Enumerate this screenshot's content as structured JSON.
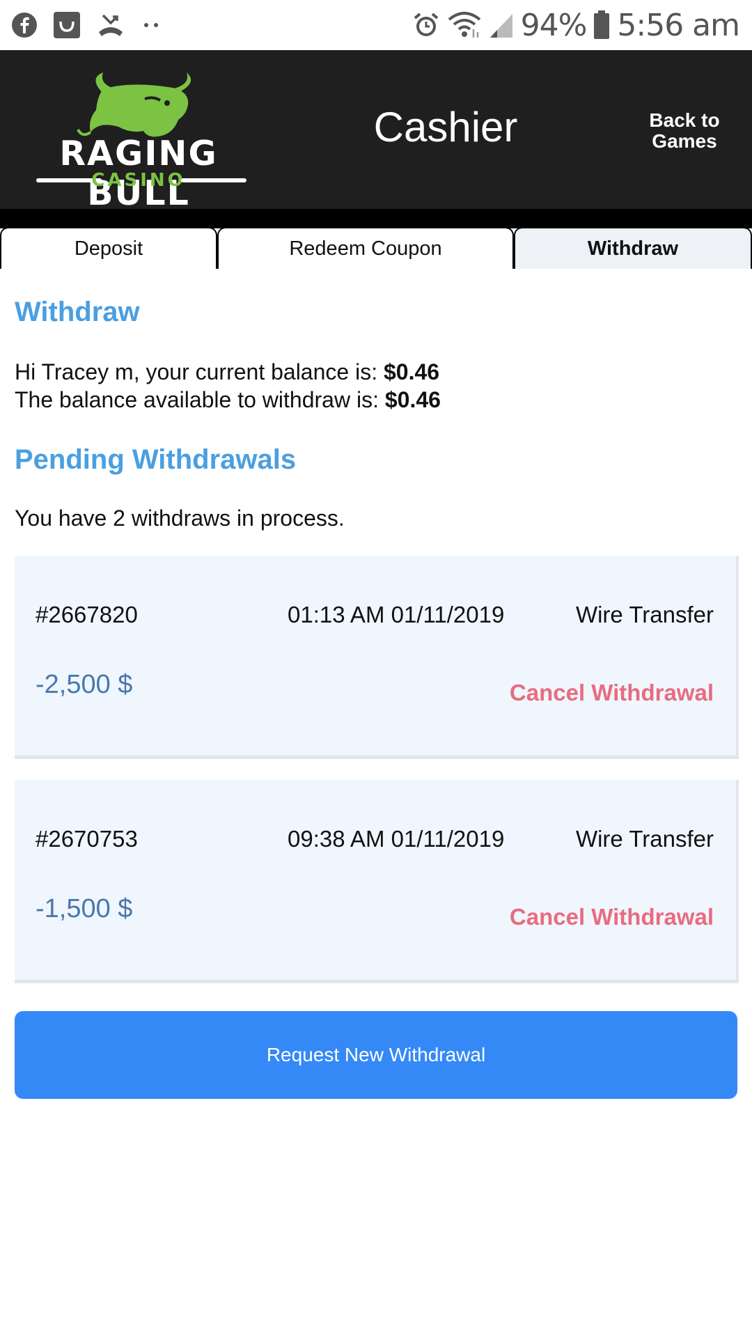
{
  "status_bar": {
    "battery": "94%",
    "time": "5:56 am",
    "icons_left": [
      "facebook-icon",
      "bag-icon",
      "missed-call-icon",
      "more-dots-icon"
    ],
    "icons_right": [
      "alarm-icon",
      "wifi-icon",
      "signal-icon",
      "battery-icon"
    ]
  },
  "header": {
    "logo_word": "RAGING BULL",
    "logo_sub": "CASINO",
    "title": "Cashier",
    "back_line1": "Back to",
    "back_line2": "Games",
    "background": "#1f1f1f",
    "logo_green": "#7cc243"
  },
  "tabs": [
    {
      "label": "Deposit",
      "active": false
    },
    {
      "label": "Redeem Coupon",
      "active": false
    },
    {
      "label": "Withdraw",
      "active": true
    }
  ],
  "withdraw": {
    "heading": "Withdraw",
    "line1_text": "Hi Tracey m, your current balance is: ",
    "current_balance": "$0.46",
    "line2_text": "The balance available to withdraw is: ",
    "available_balance": "$0.46"
  },
  "pending": {
    "heading": "Pending Withdrawals",
    "summary": "You have 2 withdraws in process.",
    "items": [
      {
        "id": "#2667820",
        "datetime": "01:13 AM 01/11/2019",
        "method": "Wire Transfer",
        "amount": "-2,500 $",
        "cancel_label": "Cancel Withdrawal"
      },
      {
        "id": "#2670753",
        "datetime": "09:38 AM 01/11/2019",
        "method": "Wire Transfer",
        "amount": "-1,500 $",
        "cancel_label": "Cancel Withdrawal"
      }
    ]
  },
  "actions": {
    "request_label": "Request New Withdrawal"
  },
  "colors": {
    "heading_blue": "#4a9fe0",
    "amount_blue": "#4a78aa",
    "cancel_pink": "#e86c80",
    "button_blue": "#3489f7",
    "card_bg": "#f0f6fd"
  }
}
